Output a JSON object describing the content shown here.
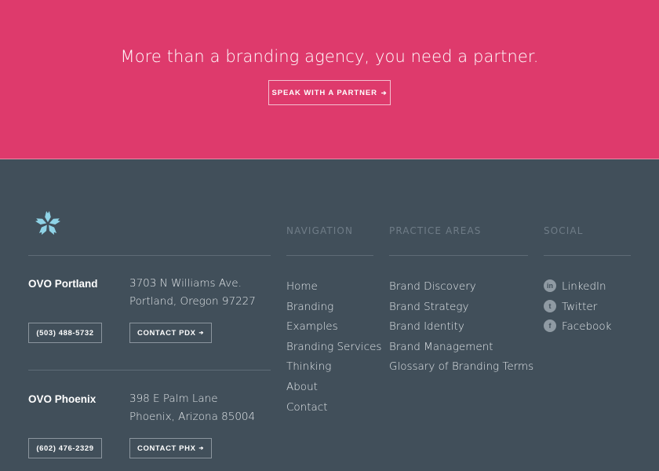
{
  "hero": {
    "headline": "More than a branding agency, you need a partner.",
    "cta_label": "SPEAK WITH A PARTNER",
    "arrow": "➔"
  },
  "footer": {
    "logo_icon": "flower-logo-icon",
    "locations": [
      {
        "name": "OVO Portland",
        "address_line1": "3703 N Williams Ave.",
        "address_line2": "Portland, Oregon 97227",
        "phone": "(503) 488-5732",
        "contact_label": "CONTACT PDX",
        "arrow": "➔"
      },
      {
        "name": "OVO Phoenix",
        "address_line1": "398 E Palm Lane",
        "address_line2": "Phoenix, Arizona 85004",
        "phone": "(602) 476-2329",
        "contact_label": "CONTACT PHX",
        "arrow": "➔"
      }
    ],
    "navigation": {
      "heading": "NAVIGATION",
      "items": [
        "Home",
        "Branding",
        "Examples",
        "Branding Services",
        "Thinking",
        "About",
        "Contact"
      ]
    },
    "practice_areas": {
      "heading": "PRACTICE AREAS",
      "items": [
        "Brand Discovery",
        "Brand Strategy",
        "Brand Identity",
        "Brand Management",
        "Glossary of Branding Terms"
      ]
    },
    "social": {
      "heading": "SOCIAL",
      "items": [
        {
          "label": "LinkedIn",
          "icon": "linkedin-icon",
          "glyph": "in"
        },
        {
          "label": "Twitter",
          "icon": "twitter-icon",
          "glyph": "t"
        },
        {
          "label": "Facebook",
          "icon": "facebook-icon",
          "glyph": "f"
        }
      ]
    },
    "colors": {
      "hero_bg": "#de3a6c",
      "footer_bg": "#414f5a",
      "logo": "#8fd3e6"
    }
  }
}
